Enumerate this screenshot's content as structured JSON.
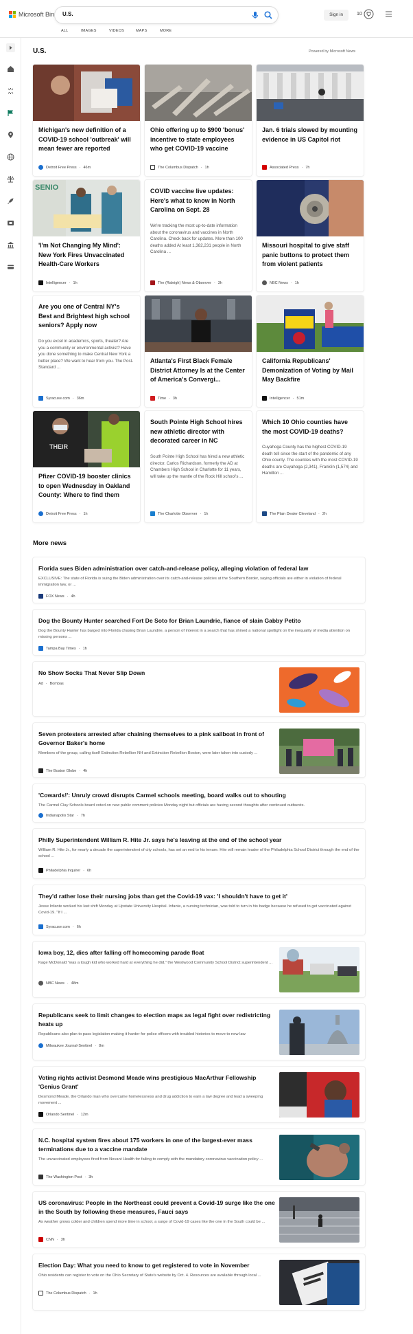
{
  "header": {
    "brand": "Microsoft Bing",
    "query": "U.S.",
    "signin": "Sign in",
    "rewards_count": "10",
    "colors": {
      "mic": "#1e73d8",
      "search": "#1e73d8"
    }
  },
  "nav": [
    "ALL",
    "IMAGES",
    "VIDEOS",
    "MAPS",
    "MORE"
  ],
  "rail_icons": [
    "expand-icon",
    "home-icon",
    "sparkle-icon",
    "flag-icon",
    "location-pin-icon",
    "globe-icon",
    "scale-icon",
    "rocket-icon",
    "film-icon",
    "bank-icon",
    "card-icon"
  ],
  "section": {
    "title": "U.S.",
    "powered": "Powered by Microsoft News"
  },
  "cards": [
    {
      "title": "Michigan's new definition of a COVID-19 school 'outbreak' will mean fewer are reported",
      "desc": "",
      "source": "Detroit Free Press",
      "age": "46m"
    },
    {
      "title": "Ohio offering up to $900 'bonus' incentive to state employees who get COVID-19 vaccine",
      "desc": "",
      "source": "The Columbus Dispatch",
      "age": "1h"
    },
    {
      "title": "Jan. 6 trials slowed by mounting evidence in US Capitol riot",
      "desc": "",
      "source": "Associated Press",
      "age": "7h"
    },
    {
      "title": "'I'm Not Changing My Mind': New York Fires Unvaccinated Health-Care Workers",
      "desc": "",
      "source": "Intelligencer",
      "age": "1h"
    },
    {
      "title": "COVID vaccine live updates: Here's what to know in North Carolina on Sept. 28",
      "desc": "We're tracking the most up-to-date information about the coronavirus and vaccines in North Carolina. Check back for updates. More than 100 deaths added At least 1,382,231 people in North Carolina ...",
      "source": "The (Raleigh) News & Observer",
      "age": "3h"
    },
    {
      "title": "Missouri hospital to give staff panic buttons to protect them from violent patients",
      "desc": "",
      "source": "NBC News",
      "age": "1h"
    },
    {
      "title": "Are you one of Central NY's Best and Brightest high school seniors? Apply now",
      "desc": "Do you excel in academics, sports, theater? Are you a community or environmental activist? Have you done something to make Central New York a better place? We want to hear from you. The Post-Standard ...",
      "source": "Syracuse.com",
      "age": "36m"
    },
    {
      "title": "Atlanta's First Black Female District Attorney Is at the Center of America's Convergi...",
      "desc": "",
      "source": "Time",
      "age": "3h"
    },
    {
      "title": "California Republicans' Demonization of Voting by Mail May Backfire",
      "desc": "",
      "source": "Intelligencer",
      "age": "51m"
    },
    {
      "title": "Pfizer COVID-19 booster clinics to open Wednesday in Oakland County: Where to find them",
      "desc": "",
      "source": "Detroit Free Press",
      "age": "1h"
    },
    {
      "title": "South Pointe High School hires new athletic director with decorated career in NC",
      "desc": "South Pointe High School has hired a new athletic director. Carlos Richardson, formerly the AD at Chambers High School in Charlotte for 11 years, will take up the mantle of the Rock Hill school's ...",
      "source": "The Charlotte Observer",
      "age": "1h"
    },
    {
      "title": "Which 10 Ohio counties have the most COVID-19 deaths?",
      "desc": "Cuyahoga County has the highest COVID-19 death toll since the start of the pandemic of any Ohio county. The counties with the most COVID-19 deaths are Cuyahoga (2,341), Franklin (1,574) and Hamilton ...",
      "source": "The Plain Dealer Cleveland",
      "age": "2h"
    }
  ],
  "more_news_title": "More news",
  "news": [
    {
      "title": "Florida sues Biden administration over catch-and-release policy, alleging violation of federal law",
      "desc": "EXCLUSIVE: The state of Florida is suing the Biden administration over its catch-and-release policies at the Southern Border, saying officials are either in violation of federal immigration law, or ...",
      "source": "FOX News",
      "age": "4h"
    },
    {
      "title": "Dog the Bounty Hunter searched Fort De Soto for Brian Laundrie, fiance of slain Gabby Petito",
      "desc": "Dog the Bounty Hunter has barged into Florida chasing Brian Laundrie, a person of interest in a search that has shined a national spotlight on the inequality of media attention on missing persons ...",
      "source": "Tampa Bay Times",
      "age": "1h"
    },
    {
      "title": "No Show Socks That Never Slip Down",
      "desc": "",
      "source": "Bombas",
      "age": "Ad"
    },
    {
      "title": "Seven protesters arrested after chaining themselves to a pink sailboat in front of Governor Baker's home",
      "desc": "Members of the group, calling itself Extinction Rebellion NH and Extinction Rebellion Boston, were later taken into custody ...",
      "source": "The Boston Globe",
      "age": "4h"
    },
    {
      "title": "'Cowards!': Unruly crowd disrupts Carmel schools meeting, board walks out to shouting",
      "desc": "The Carmel Clay Schools board voted on new public comment policies Monday night but officials are having second thoughts after continued outbursts.",
      "source": "Indianapolis Star",
      "age": "7h"
    },
    {
      "title": "Philly Superintendent William R. Hite Jr. says he's leaving at the end of the school year",
      "desc": "William R. Hite Jr., for nearly a decade the superintendent of city schools, has set an end to his tenure. Hite will remain leader of the Philadelphia School District through the end of the school ...",
      "source": "Philadelphia Inquirer",
      "age": "6h"
    },
    {
      "title": "They'd rather lose their nursing jobs than get the Covid-19 vax: 'I shouldn't have to get it'",
      "desc": "Jesse Infante worked his last shift Monday at Upstate University Hospital. Infante, a nursing technician, was told to turn in his badge because he refused to get vaccinated against Covid-19. \"If I ...",
      "source": "Syracuse.com",
      "age": "6h"
    },
    {
      "title": "Iowa boy, 12, dies after falling off homecoming parade float",
      "desc": "Kage McDonald \"was a tough kid who worked hard at everything he did,\" the Westwood Community School District superintendent ...",
      "source": "NBC News",
      "age": "48m"
    },
    {
      "title": "Republicans seek to limit changes to election maps as legal fight over redistricting heats up",
      "desc": "Republicans also plan to pass legislation making it harder for police officers with troubled histories to move to new law",
      "source": "Milwaukee Journal-Sentinel",
      "age": "8m"
    },
    {
      "title": "Voting rights activist Desmond Meade wins prestigious MacArthur Fellowship 'Genius Grant'",
      "desc": "Desmond Meade, the Orlando man who overcame homelessness and drug addiction to earn a law degree and lead a sweeping movement ...",
      "source": "Orlando Sentinel",
      "age": "12m"
    },
    {
      "title": "N.C. hospital system fires about 175 workers in one of the largest-ever mass terminations due to a vaccine mandate",
      "desc": "The unvaccinated employees fired from Novant Health for failing to comply with the mandatory coronavirus vaccination policy ...",
      "source": "The Washington Post",
      "age": "3h"
    },
    {
      "title": "US coronavirus: People in the Northeast could prevent a Covid-19 surge like the one in the South by following these measures, Fauci says",
      "desc": "As weather grows colder and children spend more time in school, a surge of Covid-19 cases like the one in the South could be ...",
      "source": "CNN",
      "age": "3h"
    },
    {
      "title": "Election Day: What you need to know to get registered to vote in November",
      "desc": "Ohio residents can register to vote on the Ohio Secretary of State's website by Oct. 4. Resources are available through local ...",
      "source": "The Columbus Dispatch",
      "age": "1h"
    }
  ]
}
